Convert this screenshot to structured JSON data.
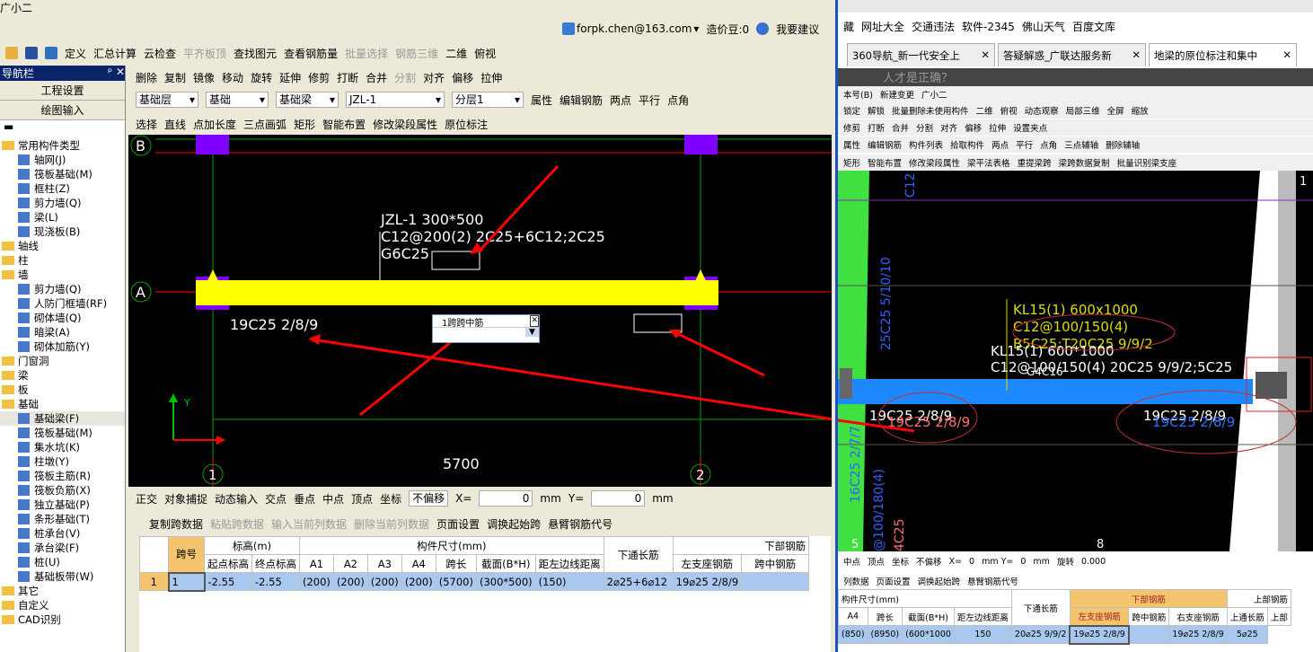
{
  "app": {
    "title": "广小二",
    "user": "forpk.chen@163.com",
    "beans": "造价豆:0",
    "suggest": "我要建议"
  },
  "toolbar1": [
    "定义",
    "汇总计算",
    "云检查",
    "平齐板顶",
    "查找图元",
    "查看钢筋量",
    "批量选择",
    "钢筋三维",
    "二维",
    "俯视"
  ],
  "toolbar2": [
    "删除",
    "复制",
    "镜像",
    "移动",
    "旋转",
    "延伸",
    "修剪",
    "打断",
    "合并",
    "分割",
    "对齐",
    "偏移",
    "拉伸"
  ],
  "toolbar3": {
    "selects": [
      "基础层",
      "基础",
      "基础梁",
      "JZL-1",
      "分层1"
    ],
    "items": [
      "属性",
      "编辑钢筋",
      "两点",
      "平行",
      "点角"
    ]
  },
  "toolbar4": [
    "选择",
    "直线",
    "点加长度",
    "三点画弧",
    "矩形",
    "智能布置",
    "修改梁段属性",
    "原位标注"
  ],
  "nav": {
    "title": "导航栏",
    "buttons": [
      "工程设置",
      "绘图输入"
    ],
    "tree": [
      {
        "t": "f",
        "l": "常用构件类型"
      },
      {
        "t": "c",
        "l": "轴网(J)"
      },
      {
        "t": "c",
        "l": "筏板基础(M)"
      },
      {
        "t": "c",
        "l": "框柱(Z)"
      },
      {
        "t": "c",
        "l": "剪力墙(Q)"
      },
      {
        "t": "c",
        "l": "梁(L)"
      },
      {
        "t": "c",
        "l": "现浇板(B)"
      },
      {
        "t": "f",
        "l": "轴线"
      },
      {
        "t": "f",
        "l": "柱"
      },
      {
        "t": "f",
        "l": "墙"
      },
      {
        "t": "c",
        "l": "剪力墙(Q)"
      },
      {
        "t": "c",
        "l": "人防门框墙(RF)"
      },
      {
        "t": "c",
        "l": "砌体墙(Q)"
      },
      {
        "t": "c",
        "l": "暗梁(A)"
      },
      {
        "t": "c",
        "l": "砌体加筋(Y)"
      },
      {
        "t": "f",
        "l": "门窗洞"
      },
      {
        "t": "f",
        "l": "梁"
      },
      {
        "t": "f",
        "l": "板"
      },
      {
        "t": "f",
        "l": "基础"
      },
      {
        "t": "c",
        "l": "基础梁(F)"
      },
      {
        "t": "c",
        "l": "筏板基础(M)"
      },
      {
        "t": "c",
        "l": "集水坑(K)"
      },
      {
        "t": "c",
        "l": "柱墩(Y)"
      },
      {
        "t": "c",
        "l": "筏板主筋(R)"
      },
      {
        "t": "c",
        "l": "筏板负筋(X)"
      },
      {
        "t": "c",
        "l": "独立基础(P)"
      },
      {
        "t": "c",
        "l": "条形基础(T)"
      },
      {
        "t": "c",
        "l": "桩承台(V)"
      },
      {
        "t": "c",
        "l": "承台梁(F)"
      },
      {
        "t": "c",
        "l": "桩(U)"
      },
      {
        "t": "c",
        "l": "基础板带(W)"
      },
      {
        "t": "f",
        "l": "其它"
      },
      {
        "t": "f",
        "l": "自定义"
      },
      {
        "t": "f",
        "l": "CAD识别"
      }
    ]
  },
  "cad": {
    "axis_top": "B",
    "axis_mid": "A",
    "axis_1": "1",
    "axis_2": "2",
    "dim": "5700",
    "label1": "JZL-1 300*500",
    "label2": "C12@200(2) 2C25+6C12;2C25",
    "label3": "G6C25",
    "bottom_left": "19C25 2/8/9",
    "popup_title": "1跨跨中筋",
    "y_axis": "Y"
  },
  "snapbar": {
    "items": [
      "正交",
      "对象捕捉",
      "动态输入",
      "交点",
      "垂点",
      "中点",
      "顶点",
      "坐标"
    ],
    "offset": "不偏移",
    "x_label": "X=",
    "x": "0",
    "y_label": "Y=",
    "y": "0",
    "unit": "mm"
  },
  "tablebar": [
    "复制跨数据",
    "粘贴跨数据",
    "输入当前列数据",
    "删除当前列数据",
    "页面设置",
    "调换起始跨",
    "悬臂钢筋代号"
  ],
  "table": {
    "h_span": "跨号",
    "h_elev": "标高(m)",
    "h_size": "构件尺寸(mm)",
    "h_bottom_long": "下通长筋",
    "h_bottom": "下部钢筋",
    "sub": [
      "起点标高",
      "终点标高",
      "A1",
      "A2",
      "A3",
      "A4",
      "跨长",
      "截面(B*H)",
      "距左边线距离",
      "左支座钢筋",
      "跨中钢筋"
    ],
    "row": {
      "index": "1",
      "span": "1",
      "cells": [
        "-2.55",
        "-2.55",
        "(200)",
        "(200)",
        "(200)",
        "(200)",
        "(5700)",
        "(300*500)",
        "(150)",
        "2⌀25+6⌀12",
        "19⌀25 2/8/9",
        ""
      ]
    }
  },
  "browser": {
    "bookmarks": [
      "藏",
      "网址大全",
      "交通违法",
      "软件-2345",
      "佛山天气",
      "百度文库"
    ],
    "tabs": [
      "360导航_新一代安全上",
      "答疑解惑_广联达服务新",
      "地梁的原位标注和集中"
    ],
    "page_heading": "人才是正确？",
    "sw_bar1": [
      "本号(B)",
      "新建变更",
      "广小二"
    ],
    "sw_bar2": [
      "锁定",
      "解锁",
      "批量删除未使用构件",
      "二维",
      "俯视",
      "动态观察",
      "局部三维",
      "全屏",
      "缩放"
    ],
    "sw_bar3": [
      "修剪",
      "打断",
      "合并",
      "分割",
      "对齐",
      "偏移",
      "拉伸",
      "设置夹点"
    ],
    "sw_bar4": [
      "属性",
      "编辑钢筋",
      "构件列表",
      "拾取构件",
      "两点",
      "平行",
      "点角",
      "三点辅轴",
      "删除辅轴"
    ],
    "sw_bar5": [
      "矩形",
      "智能布置",
      "修改梁段属性",
      "梁平法表格",
      "重提梁跨",
      "梁跨数据复制",
      "批量识别梁支座"
    ],
    "cad": {
      "y1": "KL15(1) 600x1000",
      "y2": "C12@100/150(4)",
      "y3": "B5C25;T20C25 9/9/2",
      "w1": "KL15(1) 600*1000",
      "w2": "C12@100/150(4) 20C25 9/9/2;5C25",
      "w3": "G4C16",
      "l1": "19C25 2/8/9",
      "l2": "19C25 2/8/9",
      "r1": "19C25 2/8/9",
      "r2": "19C25 2/8/9",
      "v1": "25C25 5/10/10",
      "v2": "16C25 2/7/7",
      "v3": "@100/180(4)",
      "v4": "4C25",
      "v5": "C12",
      "a5": "5",
      "a8": "8",
      "a1": "1"
    },
    "snap": [
      "中点",
      "顶点",
      "坐标",
      "不偏移",
      "X=",
      "0",
      "mm Y=",
      "0",
      "mm",
      "旋转",
      "0.000"
    ],
    "tablebar": [
      "列数据",
      "页面设置",
      "调换起始跨",
      "悬臂钢筋代号"
    ],
    "table": {
      "h_size": "构件尺寸(mm)",
      "h_long": "下通长筋",
      "h_bottom": "下部钢筋",
      "h_top": "上部钢筋",
      "sub": [
        "A4",
        "跨长",
        "截面(B*H)",
        "距左边线距离",
        "左支座钢筋",
        "跨中钢筋",
        "右支座钢筋",
        "上通长筋",
        "上部"
      ],
      "row": [
        "(850)",
        "(8950)",
        "(600*1000",
        "150",
        "20⌀25 9/9/2",
        "19⌀25 2/8/9",
        "",
        "19⌀25 2/8/9",
        "5⌀25"
      ]
    }
  },
  "colors": {
    "beam": "#ffff00",
    "column": "#8000ff",
    "grid_red": "#ff0000",
    "grid_green": "#00a000",
    "arrow": "#ff0000",
    "right_beam": "#1e88ff",
    "selection": "#a9c8f0"
  }
}
